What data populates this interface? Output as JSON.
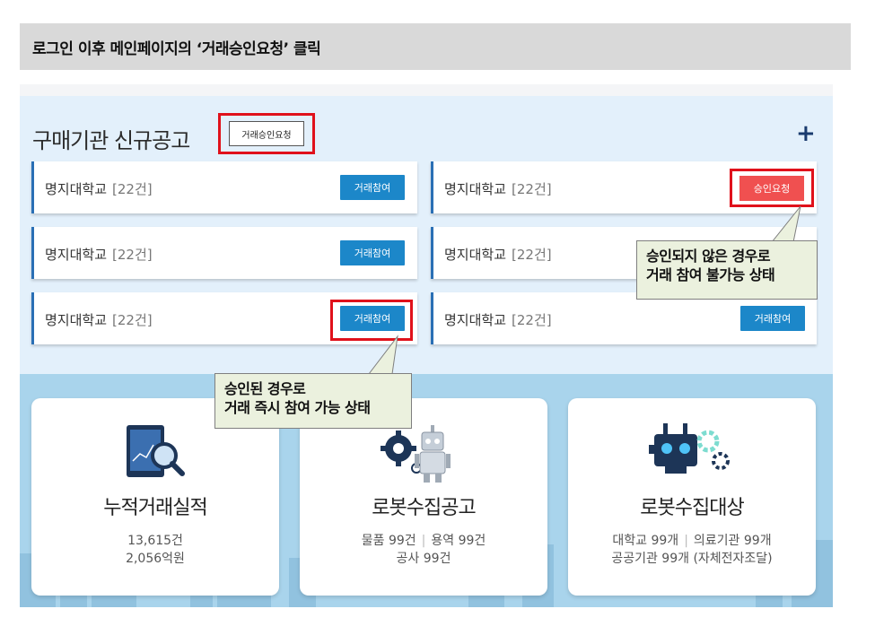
{
  "slide": {
    "instruction": "로그인 이후 메인페이지의 ‘거래승인요청’ 클릭"
  },
  "notice": {
    "title": "구매기관 신규공고",
    "request_button": "거래승인요청",
    "more_icon": "plus-icon",
    "cards": [
      {
        "name": "명지대학교",
        "count": "[22건]",
        "button": "거래참여"
      },
      {
        "name": "명지대학교",
        "count": "[22건]",
        "button": "승인요청"
      },
      {
        "name": "명지대학교",
        "count": "[22건]",
        "button": "거래참여"
      },
      {
        "name": "명지대학교",
        "count": "[22건]",
        "button": ""
      },
      {
        "name": "명지대학교",
        "count": "[22건]",
        "button": "거래참여"
      },
      {
        "name": "명지대학교",
        "count": "[22건]",
        "button": "거래참여"
      }
    ]
  },
  "callouts": {
    "not_approved_line1": "승인되지 않은 경우로",
    "not_approved_line2": "거래 참여 불가능 상태",
    "approved_line1": "승인된 경우로",
    "approved_line2": "거래 즉시 참여 가능 상태"
  },
  "stats": [
    {
      "title": "누적거래실적",
      "line1": "13,615건",
      "line2": "2,056억원",
      "icon": "tablet-chart-search-icon"
    },
    {
      "title": "로봇수집공고",
      "line1_a": "물품 99건",
      "line1_b": "용역 99건",
      "line2": "공사 99건",
      "icon": "robot-gear-icon"
    },
    {
      "title": "로봇수집대상",
      "line1_a": "대학교 99개",
      "line1_b": "의료기관 99개",
      "line2": "공공기관 99개 (자체전자조달)",
      "icon": "robot-face-icon"
    }
  ],
  "colors": {
    "accent": "#1c87c9",
    "approve": "#f05050",
    "highlight": "#e0111b",
    "callout_bg": "#ebf1de"
  }
}
